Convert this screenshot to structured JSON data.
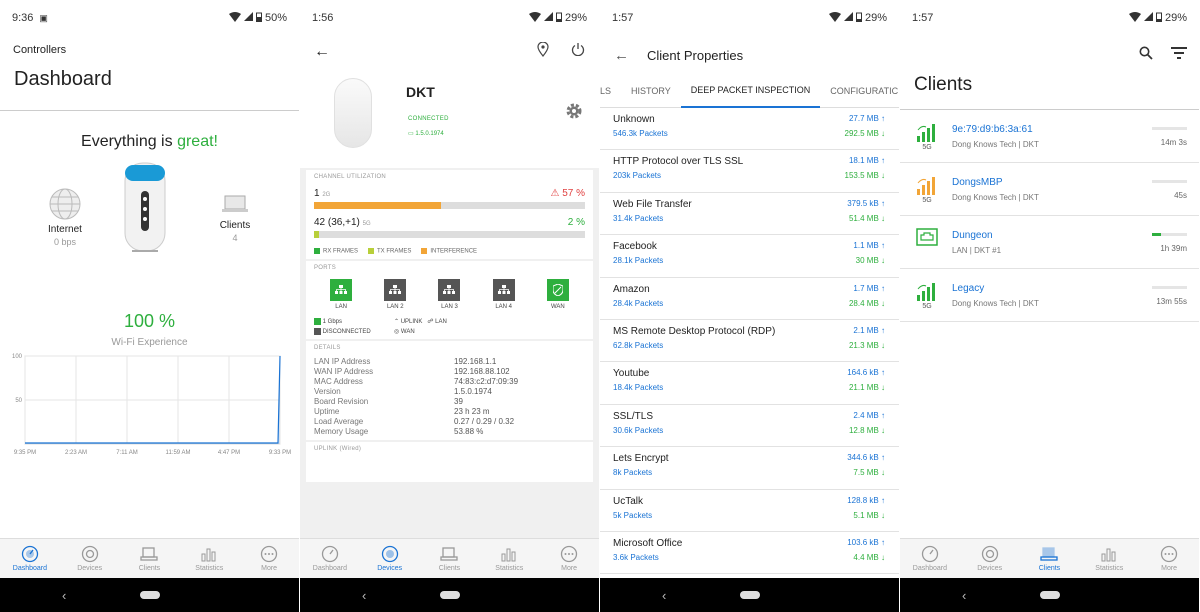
{
  "screen1": {
    "status": {
      "time": "9:36",
      "battery": "50%"
    },
    "controllers_label": "Controllers",
    "title": "Dashboard",
    "status_prefix": "Everything is",
    "status_word": "great!",
    "internet": {
      "label": "Internet",
      "value": "0 bps"
    },
    "clients": {
      "label": "Clients",
      "value": "4"
    },
    "wifi_value": "100 %",
    "wifi_label": "Wi-Fi Experience",
    "chart": {
      "y_ticks": [
        "100",
        "50"
      ],
      "x_ticks": [
        "9:35 PM",
        "2:23 AM",
        "7:11 AM",
        "11:59 AM",
        "4:47 PM",
        "9:33 PM"
      ]
    }
  },
  "chart_data": {
    "type": "area",
    "x": [
      "9:35 PM",
      "2:23 AM",
      "7:11 AM",
      "11:59 AM",
      "4:47 PM",
      "9:33 PM"
    ],
    "series": [
      {
        "values": [
          0,
          0,
          0,
          0,
          0,
          100
        ]
      }
    ],
    "ylim": [
      0,
      100
    ],
    "grid": true
  },
  "screen2": {
    "status": {
      "time": "1:56",
      "battery": "29%"
    },
    "device_name": "DKT",
    "connected": "CONNECTED",
    "version": "1.5.0.1974",
    "channel_title": "CHANNEL UTILIZATION",
    "ch1": {
      "num": "1",
      "band": "2G",
      "pct": "57 %",
      "fill": 0.47
    },
    "ch2": {
      "num": "42 (36,+1)",
      "band": "5G",
      "pct": "2 %",
      "fill": 0.02
    },
    "legend": [
      "RX FRAMES",
      "TX FRAMES",
      "INTERFERENCE"
    ],
    "ports_title": "PORTS",
    "ports": [
      "LAN",
      "LAN 2",
      "LAN 3",
      "LAN 4",
      "WAN"
    ],
    "port_legend": {
      "speed": "1 Gbps",
      "uplink": "UPLINK",
      "lan": "LAN",
      "disconnected": "DISCONNECTED",
      "wan": "WAN"
    },
    "details_title": "DETAILS",
    "details": [
      {
        "k": "LAN IP Address",
        "v": "192.168.1.1"
      },
      {
        "k": "WAN IP Address",
        "v": "192.168.88.102"
      },
      {
        "k": "MAC Address",
        "v": "74:83:c2:d7:09:39"
      },
      {
        "k": "Version",
        "v": "1.5.0.1974"
      },
      {
        "k": "Board Revision",
        "v": "39"
      },
      {
        "k": "Uptime",
        "v": "23 h 23 m"
      },
      {
        "k": "Load Average",
        "v": "0.27 / 0.29 / 0.32"
      },
      {
        "k": "Memory Usage",
        "v": "53.88 %"
      }
    ],
    "uplink_title": "UPLINK (Wired)"
  },
  "screen3": {
    "status": {
      "time": "1:57",
      "battery": "29%"
    },
    "title": "Client Properties",
    "tabs": [
      "LS",
      "HISTORY",
      "DEEP PACKET INSPECTION",
      "CONFIGURATIC"
    ],
    "protocols": [
      {
        "name": "Unknown",
        "packets": "546.3k Packets",
        "up": "27.7 MB ↑",
        "down": "292.5 MB ↓"
      },
      {
        "name": "HTTP Protocol over TLS SSL",
        "packets": "203k Packets",
        "up": "18.1 MB ↑",
        "down": "153.5 MB ↓"
      },
      {
        "name": "Web File Transfer",
        "packets": "31.4k Packets",
        "up": "379.5 kB ↑",
        "down": "51.4 MB ↓"
      },
      {
        "name": "Facebook",
        "packets": "28.1k Packets",
        "up": "1.1 MB ↑",
        "down": "30 MB ↓"
      },
      {
        "name": "Amazon",
        "packets": "28.4k Packets",
        "up": "1.7 MB ↑",
        "down": "28.4 MB ↓"
      },
      {
        "name": "MS Remote Desktop Protocol (RDP)",
        "packets": "62.8k Packets",
        "up": "2.1 MB ↑",
        "down": "21.3 MB ↓"
      },
      {
        "name": "Youtube",
        "packets": "18.4k Packets",
        "up": "164.6 kB ↑",
        "down": "21.1 MB ↓"
      },
      {
        "name": "SSL/TLS",
        "packets": "30.6k Packets",
        "up": "2.4 MB ↑",
        "down": "12.8 MB ↓"
      },
      {
        "name": "Lets Encrypt",
        "packets": "8k Packets",
        "up": "344.6 kB ↑",
        "down": "7.5 MB ↓"
      },
      {
        "name": "UcTalk",
        "packets": "5k Packets",
        "up": "128.8 kB ↑",
        "down": "5.1 MB ↓"
      },
      {
        "name": "Microsoft Office",
        "packets": "3.6k Packets",
        "up": "103.6 kB ↑",
        "down": "4.4 MB ↓"
      }
    ]
  },
  "screen4": {
    "status": {
      "time": "1:57",
      "battery": "29%"
    },
    "title": "Clients",
    "clients": [
      {
        "name": "9e:79:d9:b6:3a:61",
        "sub": "Dong Knows Tech | DKT",
        "band": "5G",
        "time": "14m 3s",
        "signal_color": "#2eaf3e",
        "activity": 0
      },
      {
        "name": "DongsMBP",
        "sub": "Dong Knows Tech | DKT",
        "band": "5G",
        "time": "45s",
        "signal_color": "#f2a537",
        "activity": 0
      },
      {
        "name": "Dungeon",
        "sub": "LAN | DKT #1",
        "band": "",
        "time": "1h 39m",
        "signal_color": "#2eaf3e",
        "activity": 0.25
      },
      {
        "name": "Legacy",
        "sub": "Dong Knows Tech | DKT",
        "band": "5G",
        "time": "13m 55s",
        "signal_color": "#2eaf3e",
        "activity": 0
      }
    ]
  },
  "tabbar": [
    "Dashboard",
    "Devices",
    "Clients",
    "Statistics",
    "More"
  ],
  "colors": {
    "accent": "#1a73d4",
    "good": "#2eaf3e",
    "warn": "#f2a537",
    "alert": "#e04040"
  }
}
